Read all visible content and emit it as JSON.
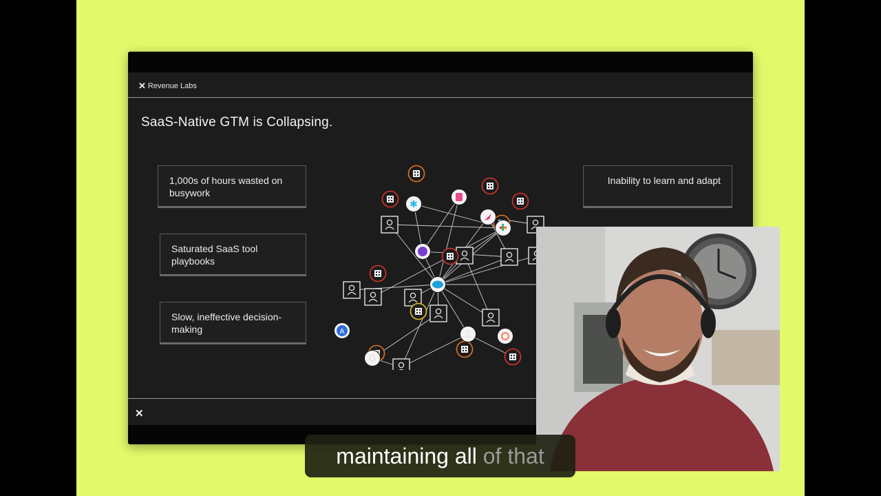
{
  "slide": {
    "brand": "Revenue Labs",
    "brand_mark": "✕",
    "title": "SaaS-Native GTM is Collapsing.",
    "cards_left": [
      "1,000s of hours wasted on busywork",
      "Saturated SaaS tool playbooks",
      "Slow, ineffective decision-making"
    ],
    "card_right": "Inability to learn and adapt",
    "footer_mark": "✕"
  },
  "network": {
    "nodes": [
      {
        "type": "user"
      },
      {
        "type": "user"
      },
      {
        "type": "user"
      },
      {
        "type": "user"
      },
      {
        "type": "user"
      },
      {
        "type": "user"
      },
      {
        "type": "user"
      },
      {
        "type": "user"
      },
      {
        "type": "user"
      },
      {
        "type": "user"
      },
      {
        "type": "user"
      },
      {
        "type": "user"
      },
      {
        "type": "building"
      },
      {
        "type": "building"
      },
      {
        "type": "building"
      },
      {
        "type": "building"
      },
      {
        "type": "building"
      },
      {
        "type": "building"
      },
      {
        "type": "building"
      },
      {
        "type": "building"
      },
      {
        "type": "building"
      },
      {
        "type": "building"
      },
      {
        "type": "building"
      },
      {
        "type": "building"
      },
      {
        "type": "app",
        "icon": "slack-icon"
      },
      {
        "type": "app",
        "icon": "snowflake-icon"
      },
      {
        "type": "app",
        "icon": "figma-icon"
      },
      {
        "type": "app",
        "icon": "rocket-icon"
      },
      {
        "type": "app",
        "icon": "gong-icon"
      },
      {
        "type": "app",
        "icon": "salesforce-icon"
      },
      {
        "type": "app",
        "icon": "apollo-icon"
      },
      {
        "type": "app",
        "icon": "google-icon"
      },
      {
        "type": "app",
        "icon": "zendesk-icon"
      },
      {
        "type": "app",
        "icon": "hubspot-icon"
      }
    ],
    "colors": {
      "red": "#d9342c",
      "orange": "#e8741f",
      "yellow": "#e3c12a",
      "blue": "#2f6ed8",
      "purple": "#7a3fd1",
      "pink": "#e8336f",
      "line": "#cfcfcf"
    }
  },
  "camera": {
    "label": "presenter webcam"
  },
  "caption": {
    "spoken": "maintaining all",
    "upcoming": "of that"
  }
}
